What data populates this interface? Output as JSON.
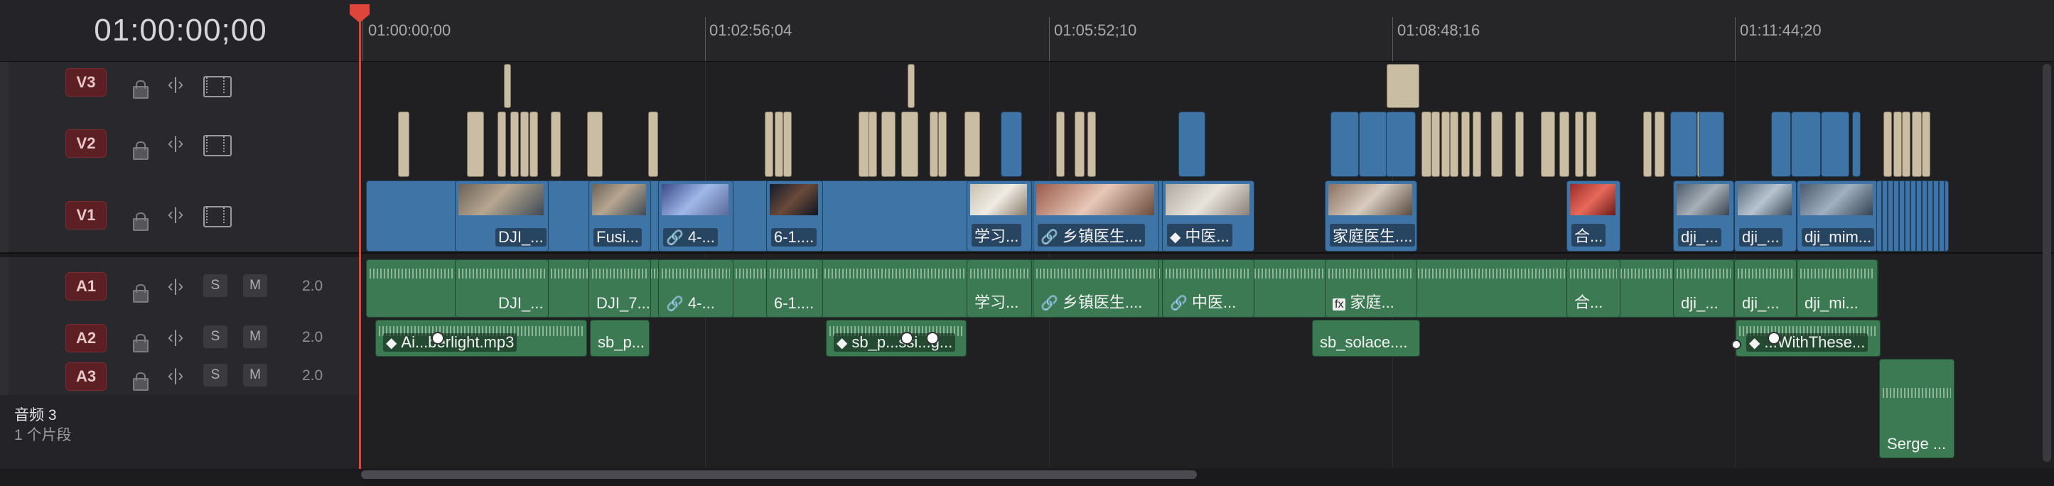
{
  "timecode": "01:00:00;00",
  "ruler_labels": [
    "01:00:00;00",
    "01:02:56;04",
    "01:05:52;10",
    "01:08:48;16",
    "01:11:44;20"
  ],
  "tracks": {
    "v3": {
      "badge": "V3"
    },
    "v2": {
      "badge": "V2"
    },
    "v1": {
      "badge": "V1"
    },
    "a1": {
      "badge": "A1",
      "solo": "S",
      "mute": "M",
      "volume": "2.0"
    },
    "a2": {
      "badge": "A2",
      "solo": "S",
      "mute": "M",
      "volume": "2.0"
    },
    "a3": {
      "badge": "A3",
      "solo": "S",
      "mute": "M",
      "volume": "2.0"
    },
    "audio3": {
      "name": "音频 3",
      "clip_count": "1 个片段"
    }
  },
  "v1_clips": [
    "DJI_...",
    "Fusi...",
    "4-...",
    "6-1....",
    "学习...",
    "乡镇医生....",
    "中医...",
    "家庭医生....",
    "合...",
    "dji_...",
    "dji_...",
    "dji_mim..."
  ],
  "a1_clips": [
    "DJI_...",
    "DJI_7...",
    "4-...",
    "6-1....",
    "学习...",
    "乡镇医生....",
    "中医...",
    "家庭...",
    "合...",
    "dji_...",
    "dji_...",
    "dji_mi..."
  ],
  "a2_clips": [
    "Ai...berlight.mp3",
    "sb_p...",
    "sb_p...ssi...g...",
    "sb_solace....",
    "...WithThese..."
  ],
  "a3_clips": [
    "Serge ..."
  ],
  "icons": {
    "lock": "lock-icon",
    "link": "link-icon",
    "film": "filmstrip-icon",
    "sync": "sync-lock-icon",
    "fx": "fx-icon",
    "keyframe": "keyframe-icon"
  }
}
